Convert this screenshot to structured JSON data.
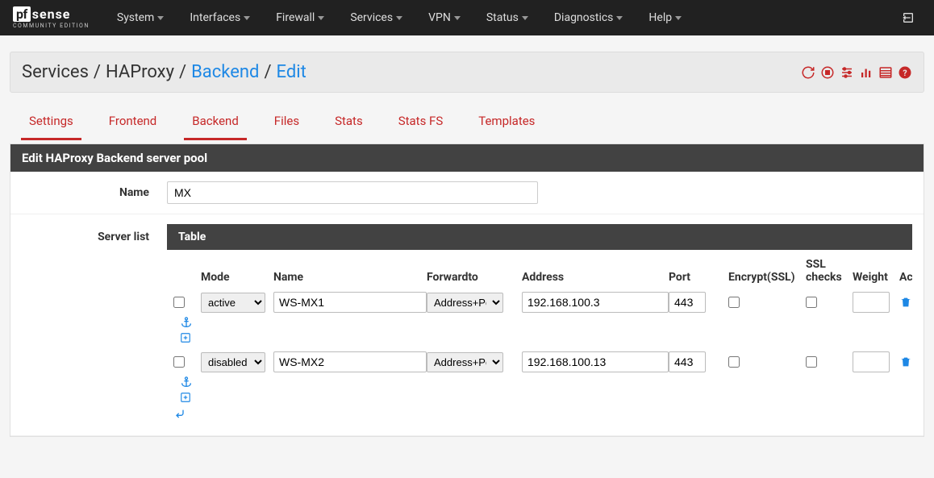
{
  "brand": {
    "pf": "pf",
    "sense": "sense",
    "sub": "COMMUNITY EDITION"
  },
  "nav": [
    "System",
    "Interfaces",
    "Firewall",
    "Services",
    "VPN",
    "Status",
    "Diagnostics",
    "Help"
  ],
  "breadcrumb": {
    "a": "Services",
    "b": "HAProxy",
    "c": "Backend",
    "d": "Edit"
  },
  "tabs": [
    "Settings",
    "Frontend",
    "Backend",
    "Files",
    "Stats",
    "Stats FS",
    "Templates"
  ],
  "active_tab_index": 2,
  "panel_title": "Edit HAProxy Backend server pool",
  "fields": {
    "name_label": "Name",
    "serverlist_label": "Server list"
  },
  "name_value": "MX",
  "table": {
    "title": "Table",
    "headers": {
      "mode": "Mode",
      "name": "Name",
      "fwd": "Forwardto",
      "addr": "Address",
      "port": "Port",
      "enc": "Encrypt(SSL)",
      "sslc": "SSL checks",
      "weight": "Weight",
      "act": "Actions"
    },
    "fwd_options": [
      "Address+Port"
    ],
    "mode_options": [
      "active",
      "disabled"
    ],
    "rows": [
      {
        "mode": "active",
        "name": "WS-MX1",
        "fwd": "Address+Port",
        "addr": "192.168.100.3",
        "port": "443",
        "enc": false,
        "sslc": false,
        "weight": ""
      },
      {
        "mode": "disabled",
        "name": "WS-MX2",
        "fwd": "Address+Port",
        "addr": "192.168.100.13",
        "port": "443",
        "enc": false,
        "sslc": false,
        "weight": ""
      }
    ]
  }
}
